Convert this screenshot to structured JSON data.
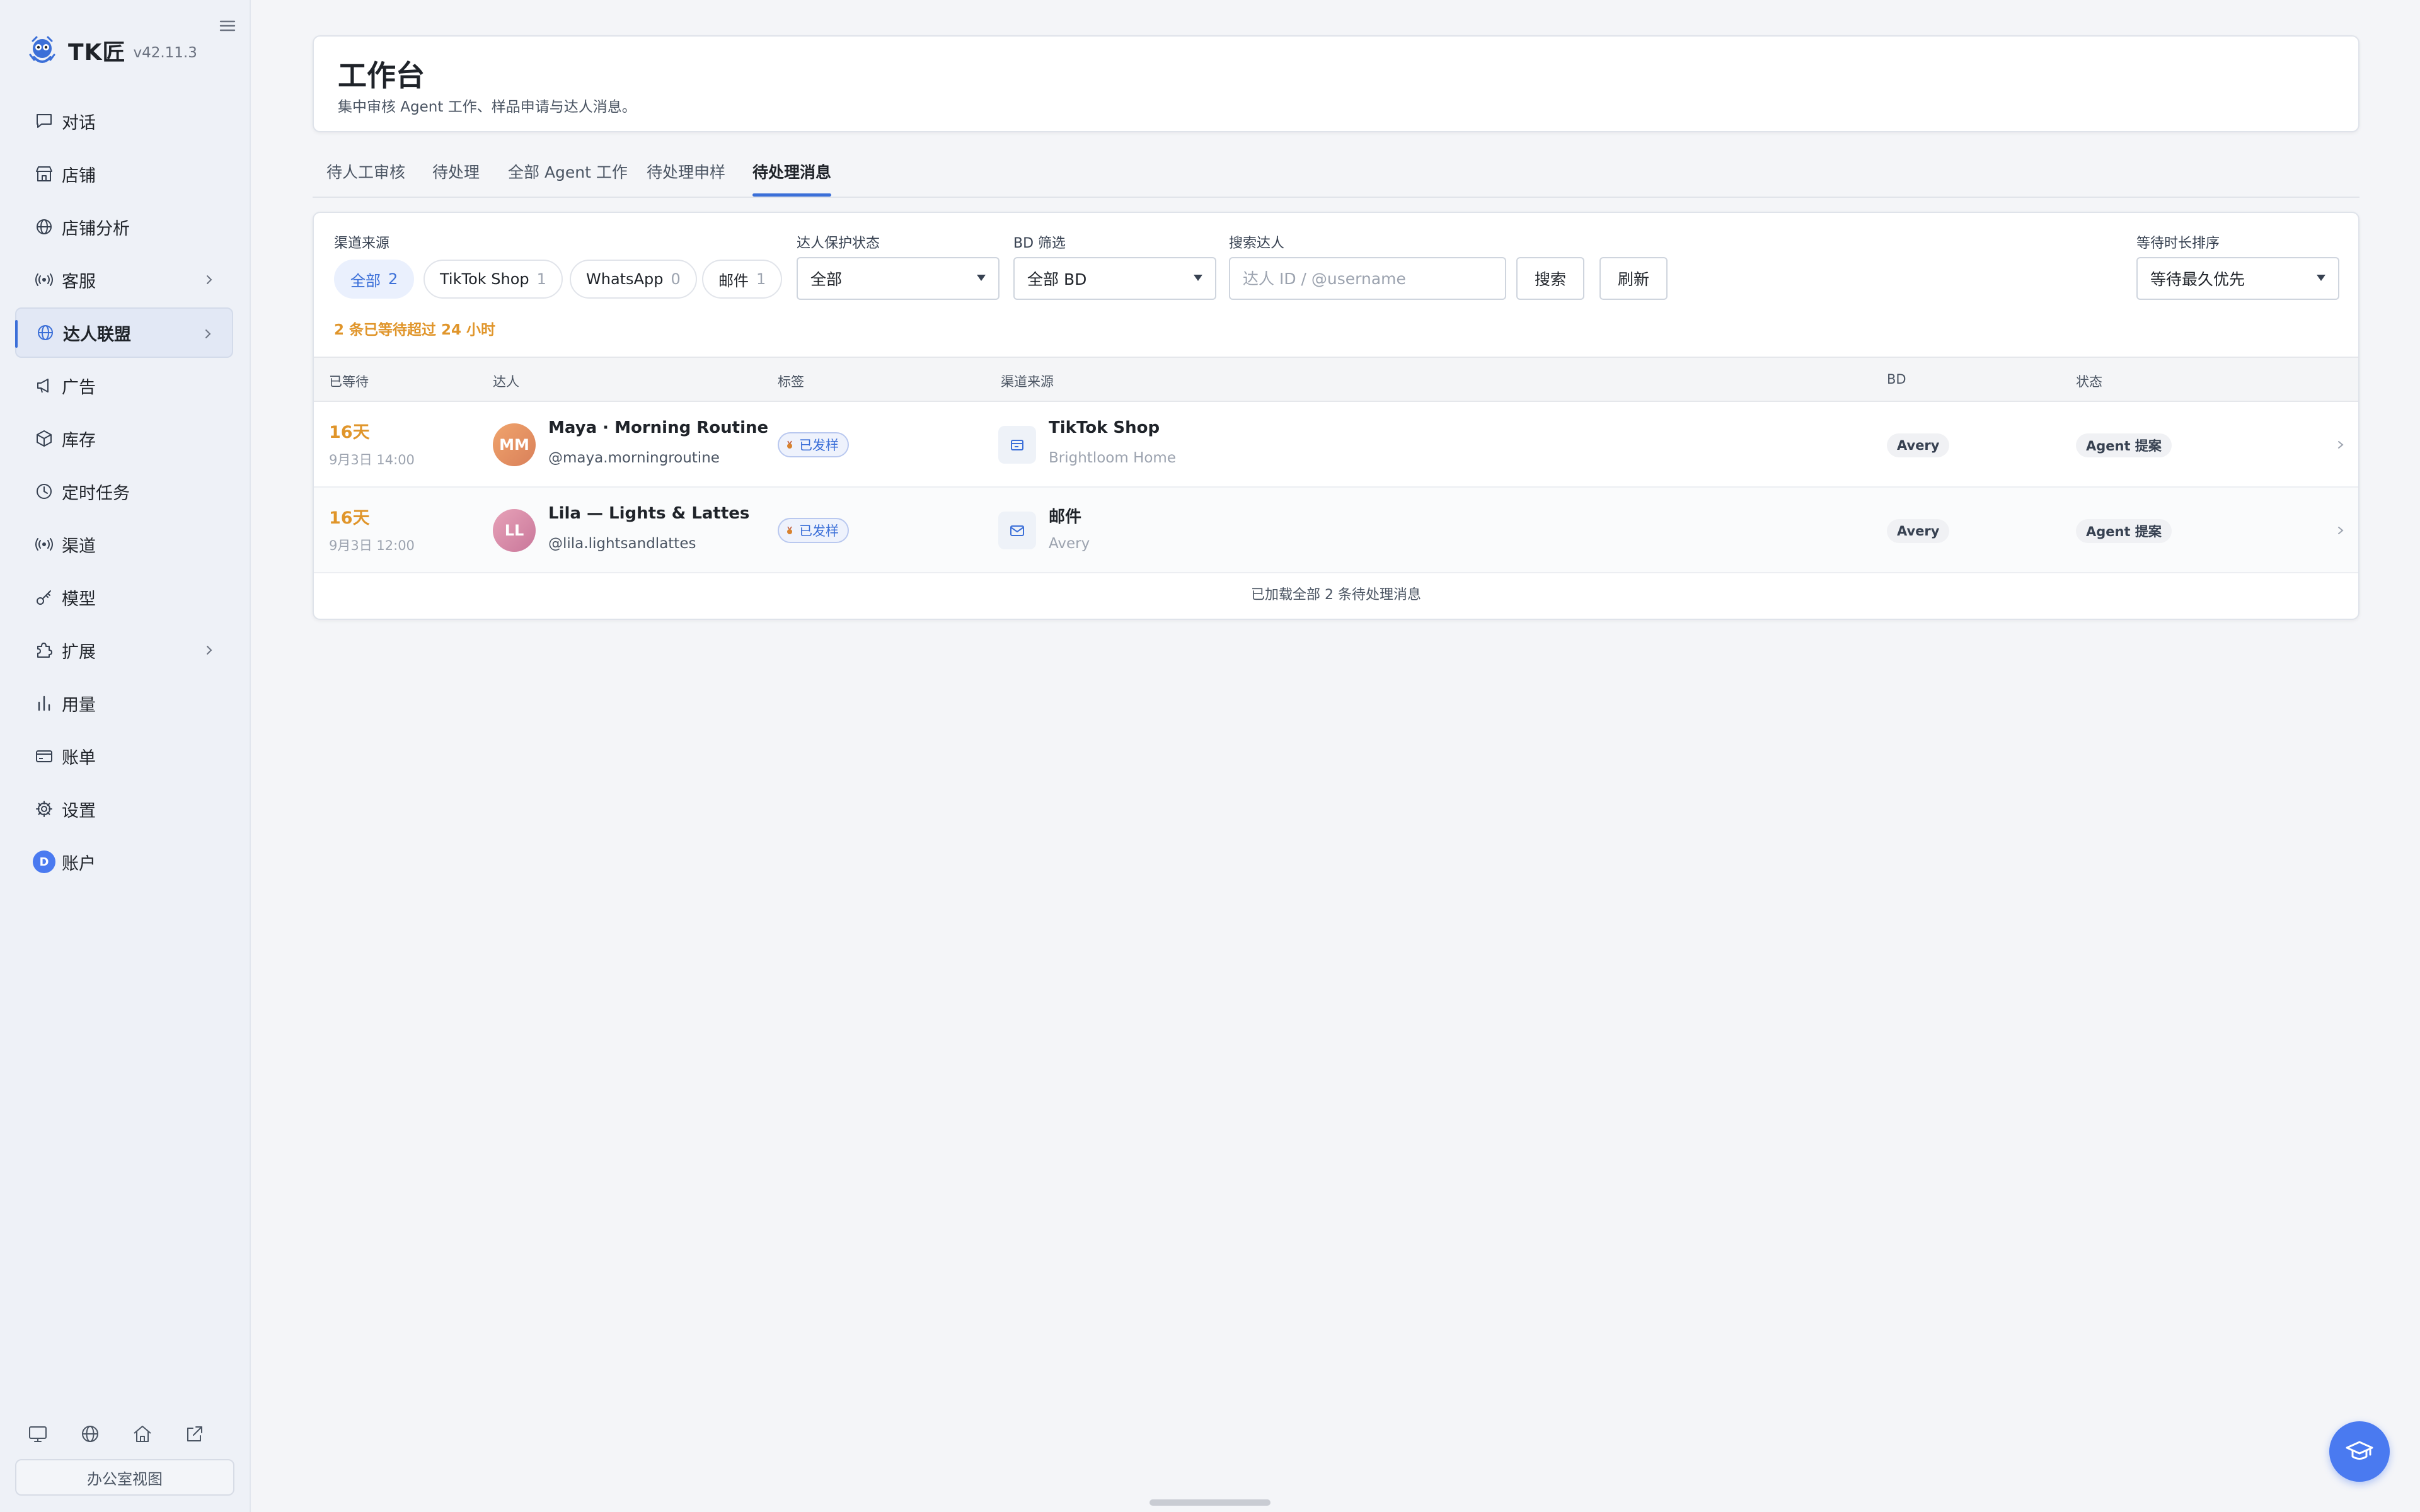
{
  "app": {
    "name": "TK匠",
    "version": "v42.11.3"
  },
  "sidebar": {
    "items": [
      {
        "label": "对话",
        "icon": "chat-icon"
      },
      {
        "label": "店铺",
        "icon": "store-icon"
      },
      {
        "label": "店铺分析",
        "icon": "globe-icon"
      },
      {
        "label": "客服",
        "icon": "broadcast-icon",
        "expandable": true
      },
      {
        "label": "达人联盟",
        "icon": "globe-icon",
        "expandable": true,
        "active": true
      },
      {
        "label": "广告",
        "icon": "megaphone-icon"
      },
      {
        "label": "库存",
        "icon": "box-icon"
      },
      {
        "label": "定时任务",
        "icon": "clock-icon"
      },
      {
        "label": "渠道",
        "icon": "broadcast-icon"
      },
      {
        "label": "模型",
        "icon": "key-icon"
      },
      {
        "label": "扩展",
        "icon": "puzzle-icon",
        "expandable": true
      },
      {
        "label": "用量",
        "icon": "bar-chart-icon"
      },
      {
        "label": "账单",
        "icon": "credit-card-icon"
      },
      {
        "label": "设置",
        "icon": "gear-icon"
      },
      {
        "label": "账户",
        "icon": "avatar",
        "avatar_letter": "D"
      }
    ],
    "footer_icons": [
      "monitor-icon",
      "globe-icon",
      "home-icon",
      "external-link-icon"
    ],
    "office_view_label": "办公室视图"
  },
  "header": {
    "title": "工作台",
    "subtitle": "集中审核 Agent 工作、样品申请与达人消息。"
  },
  "tabs": [
    {
      "label": "待人工审核"
    },
    {
      "label": "待处理"
    },
    {
      "label": "全部 Agent 工作"
    },
    {
      "label": "待处理申样"
    },
    {
      "label": "待处理消息",
      "active": true
    }
  ],
  "filters": {
    "channel_label": "渠道来源",
    "channel_chips": [
      {
        "label": "全部",
        "count": "2",
        "active": true
      },
      {
        "label": "TikTok Shop",
        "count": "1"
      },
      {
        "label": "WhatsApp",
        "count": "0"
      },
      {
        "label": "邮件",
        "count": "1"
      }
    ],
    "protect_label": "达人保护状态",
    "protect_value": "全部",
    "bd_label": "BD 筛选",
    "bd_value": "全部 BD",
    "search_label": "搜索达人",
    "search_placeholder": "达人 ID / @username",
    "search_value": "",
    "search_button": "搜索",
    "refresh_button": "刷新",
    "sort_label": "等待时长排序",
    "sort_value": "等待最久优先"
  },
  "warning": "2 条已等待超过 24 小时",
  "table": {
    "columns": [
      "已等待",
      "达人",
      "标签",
      "渠道来源",
      "BD",
      "状态"
    ],
    "rows": [
      {
        "wait_days": "16天",
        "wait_time": "9月3日 14:00",
        "initials": "MM",
        "avatar_color": "#e8955f",
        "name": "Maya · Morning Routine",
        "handle": "@maya.morningroutine",
        "tag": "已发样",
        "channel": "TikTok Shop",
        "channel_icon": "shop-icon",
        "channel_sub": "Brightloom Home",
        "bd": "Avery",
        "status": "Agent 提案"
      },
      {
        "wait_days": "16天",
        "wait_time": "9月3日 12:00",
        "initials": "LL",
        "avatar_color": "#d98aa6",
        "name": "Lila — Lights & Lattes",
        "handle": "@lila.lightsandlattes",
        "tag": "已发样",
        "channel": "邮件",
        "channel_icon": "mail-icon",
        "channel_sub": "Avery",
        "bd": "Avery",
        "status": "Agent 提案"
      }
    ],
    "footer": "已加载全部 2 条待处理消息"
  },
  "colors": {
    "accent": "#3b6fd8",
    "warning": "#e0952a",
    "fab": "#4a7af0"
  }
}
